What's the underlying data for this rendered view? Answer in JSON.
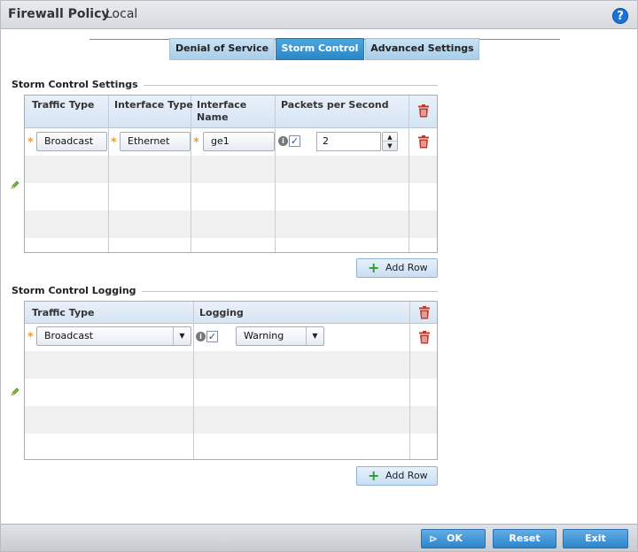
{
  "header": {
    "title": "Firewall Policy",
    "subtitle": "Local",
    "help_glyph": "?"
  },
  "tabs": [
    {
      "label": "Denial of Service",
      "active": false
    },
    {
      "label": "Storm Control",
      "active": true
    },
    {
      "label": "Advanced Settings",
      "active": false
    }
  ],
  "storm_settings": {
    "title": "Storm Control Settings",
    "columns": {
      "traffic_type": "Traffic Type",
      "interface_type": "Interface Type",
      "interface_name_1": "Interface",
      "interface_name_2": "Name",
      "pps": "Packets per Second"
    },
    "rows": [
      {
        "traffic_type": "Broadcast",
        "interface_type": "Ethernet",
        "interface_name": "ge1",
        "pps_enabled": true,
        "pps_value": "2"
      }
    ],
    "add_row_label": "Add Row"
  },
  "storm_logging": {
    "title": "Storm Control Logging",
    "columns": {
      "traffic_type": "Traffic Type",
      "logging": "Logging"
    },
    "rows": [
      {
        "traffic_type": "Broadcast",
        "logging_enabled": true,
        "logging_level": "Warning"
      }
    ],
    "add_row_label": "Add Row"
  },
  "footer": {
    "ok_label": "OK",
    "reset_label": "Reset",
    "exit_label": "Exit"
  },
  "colors": {
    "accent": "#2b86c6",
    "trash": "#c0392b",
    "required": "#f0a030",
    "add_icon": "#2e9b2e"
  },
  "icons": {
    "delete": "trash-icon",
    "required": "asterisk-icon",
    "edit": "pencil-icon",
    "add": "plus-icon",
    "help": "help-icon",
    "info": "info-icon",
    "ok": "ok-arrow-icon"
  }
}
